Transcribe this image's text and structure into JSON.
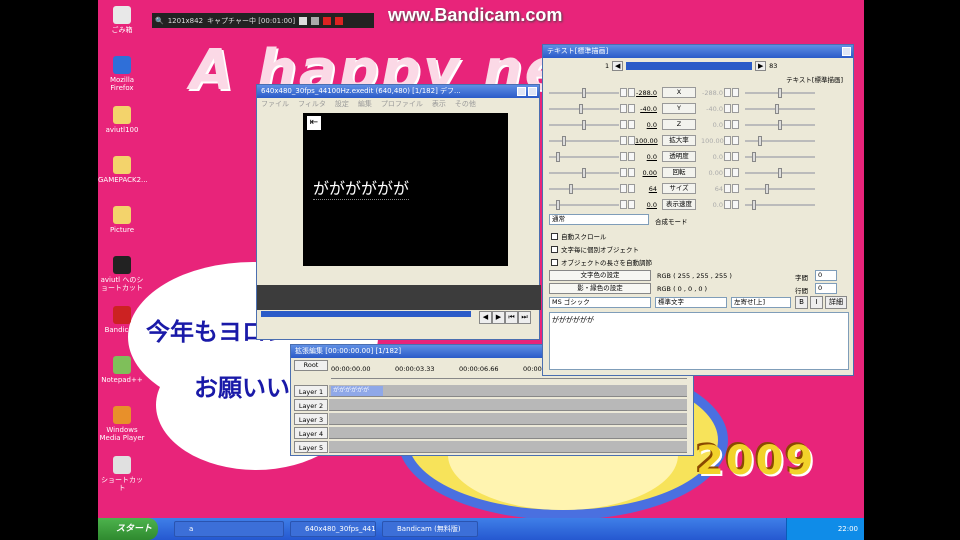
{
  "recorder": {
    "watermark": "www.Bandicam.com",
    "capture_size": "1201x842",
    "capture_status": "キャプチャー中 [00:01:00]"
  },
  "wallpaper": {
    "greeting": "A happy new",
    "line1": "今年もヨロシ",
    "line2": "お願いい",
    "year": "2009"
  },
  "desktop_icons": [
    {
      "label": "ごみ箱",
      "icon": "recycle-bin-icon",
      "color": "#e8e8e8"
    },
    {
      "label": "Mozilla Firefox",
      "icon": "firefox-icon",
      "color": "#2f6fd8"
    },
    {
      "label": "aviutl100",
      "icon": "folder-icon",
      "color": "#f3d36b"
    },
    {
      "label": "GAMEPACK2...",
      "icon": "folder-icon",
      "color": "#f3d36b"
    },
    {
      "label": "Picture",
      "icon": "folder-icon",
      "color": "#f3d36b"
    },
    {
      "label": "aviutl へのショートカット",
      "icon": "film-icon",
      "color": "#222222"
    },
    {
      "label": "Bandicam",
      "icon": "bandicam-icon",
      "color": "#cc2222"
    },
    {
      "label": "Notepad++",
      "icon": "notepad-icon",
      "color": "#7fbf5a"
    },
    {
      "label": "Windows Media Player",
      "icon": "media-player-icon",
      "color": "#e8902a"
    },
    {
      "label": "ショートカット",
      "icon": "shortcut-icon",
      "color": "#e0e0e0"
    }
  ],
  "preview": {
    "title": "640x480_30fps_44100Hz.exedit (640,480) [1/182] デフ...",
    "menu": [
      "ファイル",
      "フィルタ",
      "設定",
      "編集",
      "プロファイル",
      "表示",
      "その他"
    ],
    "caption": "がががががが"
  },
  "timeline": {
    "title": "拡張編集 [00:00:00.00] [1/182]",
    "root": "Root",
    "times": [
      "00:00:00.00",
      "00:00:03.33",
      "00:00:06.66",
      "00:00:09.99"
    ],
    "clip": "がががががが",
    "layers": [
      "Layer 1",
      "Layer 2",
      "Layer 3",
      "Layer 4",
      "Layer 5"
    ]
  },
  "text_panel": {
    "title": "テキスト[標準描画]",
    "frame_start": "1",
    "frame_end": "83",
    "object_type": "テキスト[標準描画]",
    "params": [
      {
        "label": "X",
        "value": "-288.0",
        "right": "-288.0",
        "pos": 0.5
      },
      {
        "label": "Y",
        "value": "-40.0",
        "right": "-40.0",
        "pos": 0.45
      },
      {
        "label": "Z",
        "value": "0.0",
        "right": "0.0",
        "pos": 0.5
      },
      {
        "label": "拡大率",
        "value": "100.00",
        "right": "100.00",
        "pos": 0.2
      },
      {
        "label": "透明度",
        "value": "0.0",
        "right": "0.0",
        "pos": 0.1
      },
      {
        "label": "回転",
        "value": "0.00",
        "right": "0.00",
        "pos": 0.5
      },
      {
        "label": "サイズ",
        "value": "64",
        "right": "64",
        "pos": 0.3
      },
      {
        "label": "表示速度",
        "value": "0.0",
        "right": "0.0",
        "pos": 0.1
      }
    ],
    "blend_mode": "通常",
    "blend_label": "合成モード",
    "checks": [
      "自動スクロール",
      "文字毎に個別オブジェクト",
      "オブジェクトの長さを自動調節"
    ],
    "text_color_button": "文字色の設定",
    "text_color_value": "RGB ( 255 , 255 , 255 )",
    "shadow_color_button": "影・縁色の設定",
    "shadow_color_value": "RGB ( 0 , 0 , 0 )",
    "spacing_label": "字間",
    "spacing": "0",
    "line_label": "行間",
    "line": "0",
    "font": "MS ゴシック",
    "style": "標準文字",
    "align": "左寄せ[上]",
    "bold": "B",
    "italic": "I",
    "detail": "詳細",
    "text_content": "がががががが"
  },
  "taskbar": {
    "start": "スタート",
    "tasks": [
      "a",
      "640x480_30fps_44100...",
      "Bandicam (無料版)"
    ],
    "clock": "22:00"
  }
}
